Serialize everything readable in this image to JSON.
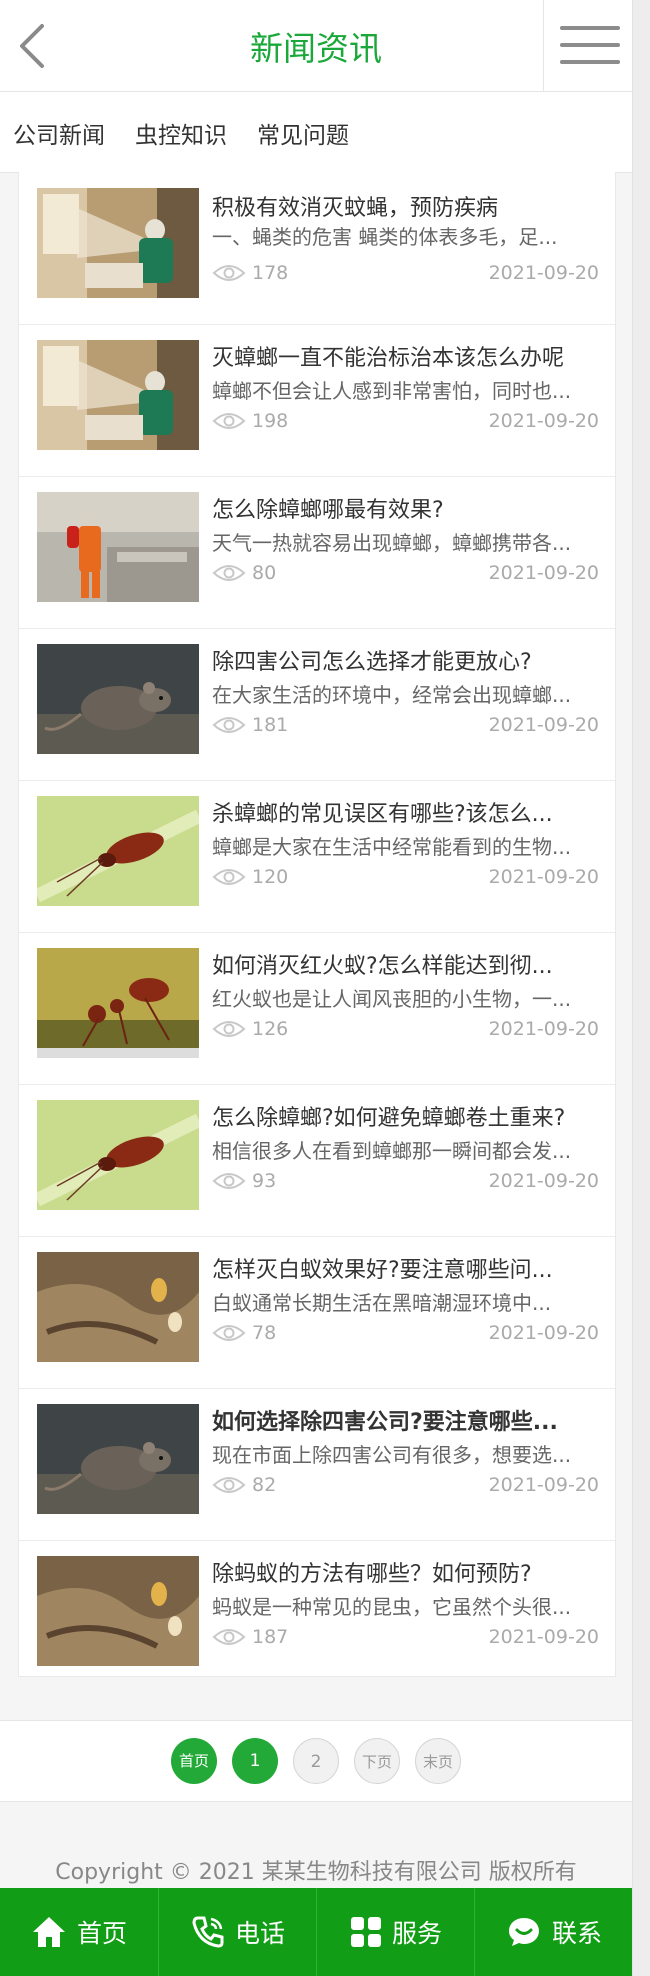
{
  "header": {
    "title": "新闻资讯",
    "back_icon": "back-arrow-icon",
    "menu_icon": "hamburger-menu-icon"
  },
  "tabs": [
    "公司新闻",
    "虫控知识",
    "常见问题"
  ],
  "articles": [
    {
      "title": "积极有效消灭蚊蝇，预防疾病",
      "desc": "一、蝇类的危害 蝇类的体表多毛，足...",
      "views": "178",
      "date": "2021-09-20"
    },
    {
      "title": "灭蟑螂一直不能治标治本该怎么办呢",
      "desc": "蟑螂不但会让人感到非常害怕，同时也...",
      "views": "198",
      "date": "2021-09-20"
    },
    {
      "title": "怎么除蟑螂哪最有效果?",
      "desc": "天气一热就容易出现蟑螂，蟑螂携带各...",
      "views": "80",
      "date": "2021-09-20"
    },
    {
      "title": "除四害公司怎么选择才能更放心?",
      "desc": "在大家生活的环境中，经常会出现蟑螂...",
      "views": "181",
      "date": "2021-09-20"
    },
    {
      "title": "杀蟑螂的常见误区有哪些?该怎么...",
      "desc": "蟑螂是大家在生活中经常能看到的生物...",
      "views": "120",
      "date": "2021-09-20"
    },
    {
      "title": "如何消灭红火蚁?怎么样能达到彻...",
      "desc": "红火蚁也是让人闻风丧胆的小生物，一...",
      "views": "126",
      "date": "2021-09-20"
    },
    {
      "title": "怎么除蟑螂?如何避免蟑螂卷土重来?",
      "desc": "相信很多人在看到蟑螂那一瞬间都会发...",
      "views": "93",
      "date": "2021-09-20"
    },
    {
      "title": "怎样灭白蚁效果好?要注意哪些问...",
      "desc": "白蚁通常长期生活在黑暗潮湿环境中...",
      "views": "78",
      "date": "2021-09-20"
    },
    {
      "title": "如何选择除四害公司?要注意哪些...",
      "desc": "现在市面上除四害公司有很多，想要选...",
      "views": "82",
      "date": "2021-09-20"
    },
    {
      "title": "除蚂蚁的方法有哪些？如何预防?",
      "desc": "蚂蚁是一种常见的昆虫，它虽然个头很...",
      "views": "187",
      "date": "2021-09-20"
    }
  ],
  "pagination": {
    "first": "首页",
    "current": "1",
    "page2": "2",
    "next": "下页",
    "last": "末页"
  },
  "footer": {
    "copyright": "Copyright © 2021 某某生物科技有限公司 版权所有"
  },
  "bottom_nav": [
    {
      "label": "首页",
      "icon": "home-icon"
    },
    {
      "label": "电话",
      "icon": "phone-icon"
    },
    {
      "label": "服务",
      "icon": "grid-icon"
    },
    {
      "label": "联系",
      "icon": "chat-icon"
    }
  ],
  "colors": {
    "brand_green": "#1aa83a",
    "nav_green": "#129d16"
  }
}
